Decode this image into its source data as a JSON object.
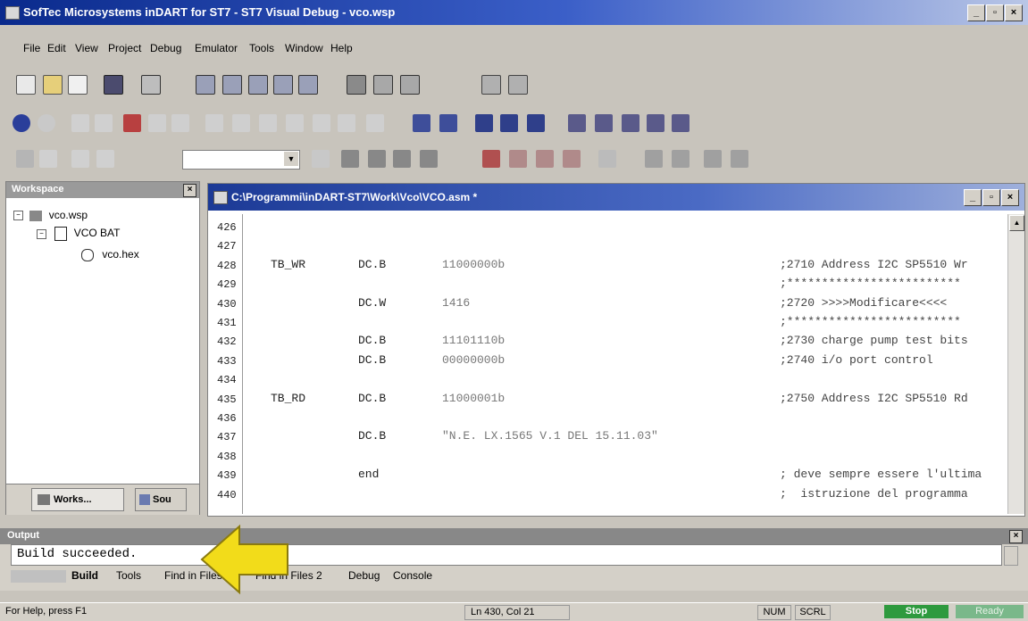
{
  "window": {
    "title": "SofTec Microsystems inDART for ST7 - ST7 Visual Debug - vco.wsp",
    "buttons": [
      "_",
      "и",
      "X"
    ]
  },
  "menu": [
    "File",
    "Edit",
    "View",
    "Project",
    "Debug",
    "Emulator",
    "Tools",
    "Window",
    "Help"
  ],
  "workspace": {
    "title": "Workspace",
    "tree": [
      "vco.wsp",
      "VCO BAT",
      "vco.hex"
    ],
    "tabs": [
      "Works...",
      "Sou"
    ]
  },
  "editor": {
    "title": "C:\\Programmi\\inDART-ST7\\Work\\Vco\\VCO.asm *",
    "lines": [
      {
        "n": "426",
        "label": "",
        "op": "",
        "arg": "",
        "cmt": ""
      },
      {
        "n": "427",
        "label": "",
        "op": "",
        "arg": "",
        "cmt": ""
      },
      {
        "n": "428",
        "label": "TB_WR",
        "op": "DC.B",
        "arg": "11000000b",
        "cmt": ";2710 Address I2C SP5510 Wr"
      },
      {
        "n": "429",
        "label": "",
        "op": "",
        "arg": "",
        "cmt": ";*************************"
      },
      {
        "n": "430",
        "label": "",
        "op": "DC.W",
        "arg": "1416",
        "cmt": ";2720 >>>>Modificare<<<<"
      },
      {
        "n": "431",
        "label": "",
        "op": "",
        "arg": "",
        "cmt": ";*************************"
      },
      {
        "n": "432",
        "label": "",
        "op": "DC.B",
        "arg": "11101110b",
        "cmt": ";2730 charge pump test bits"
      },
      {
        "n": "433",
        "label": "",
        "op": "DC.B",
        "arg": "00000000b",
        "cmt": ";2740 i/o port control"
      },
      {
        "n": "434",
        "label": "",
        "op": "",
        "arg": "",
        "cmt": ""
      },
      {
        "n": "435",
        "label": "TB_RD",
        "op": "DC.B",
        "arg": "11000001b",
        "cmt": ";2750 Address I2C SP5510 Rd"
      },
      {
        "n": "436",
        "label": "",
        "op": "",
        "arg": "",
        "cmt": ""
      },
      {
        "n": "437",
        "label": "",
        "op": "DC.B",
        "arg": "\"N.E. LX.1565 V.1 DEL 15.11.03\"",
        "cmt": ""
      },
      {
        "n": "438",
        "label": "",
        "op": "",
        "arg": "",
        "cmt": ""
      },
      {
        "n": "439",
        "label": "",
        "op": "end",
        "arg": "",
        "cmt": "; deve sempre essere l'ultima"
      },
      {
        "n": "440",
        "label": "",
        "op": "",
        "arg": "",
        "cmt": ";  istruzione del programma"
      }
    ]
  },
  "output": {
    "title": "Output",
    "message": "Build succeeded.",
    "tabs": [
      "Build",
      "Tools",
      "Find in Files 1",
      "Find in Files 2",
      "Debug",
      "Console"
    ]
  },
  "status": {
    "help": "For Help, press F1",
    "position": "Ln 430, Col 21",
    "num": "NUM",
    "scrl": "SCRL",
    "stop": "Stop",
    "ready": "Ready"
  },
  "colors": {
    "arrow": "#f2dc1a",
    "stop_bg": "#2e9a3e",
    "ready_bg": "#7ab88a"
  }
}
